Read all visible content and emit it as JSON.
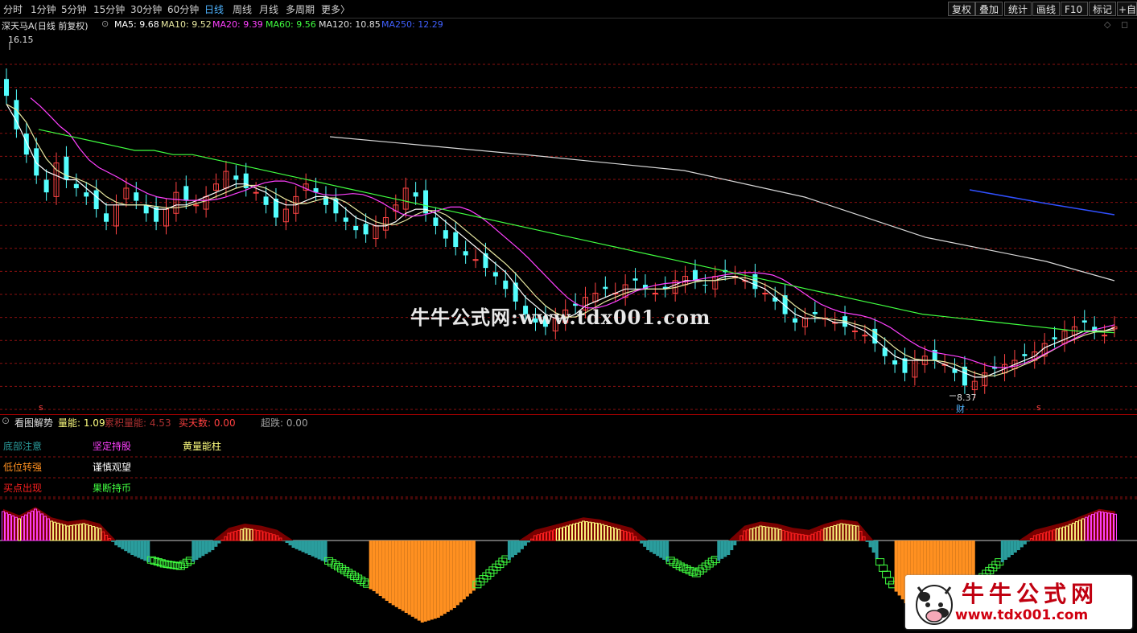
{
  "toolbar": {
    "periods": [
      "分时",
      "1分钟",
      "5分钟",
      "15分钟",
      "30分钟",
      "60分钟",
      "日线",
      "周线",
      "月线",
      "多周期",
      "更多〉"
    ],
    "active_period": "日线",
    "tools": [
      "复权",
      "叠加",
      "统计",
      "画线",
      "F10",
      "标记",
      "+自选"
    ]
  },
  "stock": {
    "name_label": "深天马A(日线 前复权)",
    "ma": [
      {
        "label": "MA5: 9.68",
        "color": "#ffffff"
      },
      {
        "label": "MA10: 9.52",
        "color": "#e8e8a0"
      },
      {
        "label": "MA20: 9.39",
        "color": "#ff40ff"
      },
      {
        "label": "MA60: 9.56",
        "color": "#40ff40"
      },
      {
        "label": "MA120: 10.85",
        "color": "#e0e0e0"
      },
      {
        "label": "MA250: 12.29",
        "color": "#4060ff"
      }
    ],
    "high_label": "16.15",
    "low_label": "8.37",
    "marker_cai": "财",
    "marker_s": "s"
  },
  "indicator": {
    "name": "看图解势",
    "values": [
      {
        "label": "量能: 1.09",
        "color": "#ffff80"
      },
      {
        "label": "累积量能: 4.53",
        "color": "#aa3030"
      },
      {
        "label": "买天数: 0.00",
        "color": "#ff4040"
      },
      {
        "label": "超跌: 0.00",
        "color": "#a0a0a0"
      }
    ],
    "legend": [
      {
        "text": "底部注意",
        "color": "#2a9d9d"
      },
      {
        "text": "坚定持股",
        "color": "#ff40ff"
      },
      {
        "text": "黄量能柱",
        "color": "#ffff80"
      },
      {
        "text": "低位转强",
        "color": "#ff9020"
      },
      {
        "text": "谨慎观望",
        "color": "#ffffff"
      },
      {
        "text": "买点出现",
        "color": "#ff2020"
      },
      {
        "text": "果断持币",
        "color": "#40ff40"
      }
    ]
  },
  "watermark": "牛牛公式网:www.tdx001.com",
  "logo": {
    "name": "牛牛公式网",
    "url": "www.tdx001.com"
  },
  "chart_data": [
    {
      "type": "candlestick",
      "title": "深天马A(日线 前复权)",
      "ylim": [
        8.0,
        16.6
      ],
      "grid": true,
      "annotated_high": 16.15,
      "annotated_low": 8.37,
      "series": [
        {
          "name": "close",
          "values": [
            15.2,
            14.4,
            13.8,
            13.3,
            12.9,
            13.6,
            13.2,
            13.0,
            12.8,
            12.5,
            12.2,
            12.6,
            13.0,
            12.7,
            12.4,
            12.2,
            12.5,
            12.9,
            12.7,
            12.6,
            12.8,
            13.1,
            13.4,
            13.2,
            13.0,
            12.9,
            12.6,
            12.3,
            12.5,
            12.8,
            13.1,
            12.9,
            12.6,
            12.4,
            12.2,
            12.0,
            11.9,
            12.1,
            12.3,
            12.6,
            13.0,
            12.8,
            12.4,
            12.1,
            11.8,
            11.6,
            11.4,
            11.3,
            11.1,
            10.9,
            10.6,
            10.3,
            10.0,
            9.8,
            9.7,
            9.9,
            10.1,
            10.2,
            10.4,
            10.5,
            10.6,
            10.5,
            10.7,
            10.8,
            10.6,
            10.5,
            10.6,
            10.8,
            10.9,
            10.8,
            10.7,
            10.9,
            11.0,
            10.9,
            10.8,
            10.6,
            10.5,
            10.3,
            10.0,
            9.8,
            9.9,
            10.0,
            9.9,
            9.8,
            9.7,
            9.6,
            9.5,
            9.3,
            9.0,
            8.8,
            8.6,
            8.9,
            9.0,
            8.9,
            8.8,
            8.6,
            8.3,
            8.4,
            8.6,
            8.7,
            8.8,
            8.9,
            9.0,
            9.1,
            9.3,
            9.4,
            9.6,
            9.7,
            9.8,
            9.6,
            9.5,
            9.7
          ]
        },
        {
          "name": "MA5",
          "values": [
            15.0,
            14.6,
            14.1,
            13.6,
            13.4,
            13.3,
            13.2,
            13.2,
            13.0,
            12.8,
            12.6,
            12.6,
            12.6,
            12.6,
            12.6,
            12.5,
            12.5,
            12.6,
            12.6,
            12.7,
            12.8,
            12.9,
            13.0,
            13.1,
            13.1,
            13.0,
            12.9,
            12.7,
            12.6,
            12.6,
            12.7,
            12.8,
            12.8,
            12.7,
            12.5,
            12.3,
            12.2,
            12.1,
            12.1,
            12.2,
            12.4,
            12.5,
            12.5,
            12.4,
            12.2,
            12.0,
            11.8,
            11.6,
            11.4,
            11.2,
            11.0,
            10.7,
            10.4,
            10.2,
            10.0,
            9.9,
            9.9,
            10.0,
            10.2,
            10.3,
            10.4,
            10.5,
            10.6,
            10.6,
            10.6,
            10.6,
            10.6,
            10.7,
            10.8,
            10.8,
            10.8,
            10.8,
            10.9,
            10.9,
            10.8,
            10.7,
            10.6,
            10.4,
            10.2,
            10.0,
            9.9,
            9.9,
            9.9,
            9.8,
            9.8,
            9.7,
            9.6,
            9.4,
            9.2,
            9.0,
            8.9,
            8.9,
            8.9,
            8.9,
            8.8,
            8.7,
            8.6,
            8.5,
            8.5,
            8.6,
            8.7,
            8.8,
            8.9,
            9.0,
            9.2,
            9.3,
            9.4,
            9.5,
            9.6,
            9.6,
            9.6,
            9.68
          ]
        },
        {
          "name": "MA60",
          "values": [
            14.4,
            14.3,
            14.2,
            14.1,
            14.0,
            13.9,
            13.9,
            13.8,
            13.8,
            13.7,
            13.6,
            13.5,
            13.4,
            13.3,
            13.2,
            13.1,
            13.0,
            12.9,
            12.8,
            12.7,
            12.6,
            12.5,
            12.4,
            12.3,
            12.2,
            12.1,
            12.0,
            11.9,
            11.8,
            11.7,
            11.6,
            11.5,
            11.4,
            11.3,
            11.2,
            11.1,
            11.0,
            10.9,
            10.8,
            10.7,
            10.6,
            10.5,
            10.4,
            10.3,
            10.2,
            10.1,
            10.0,
            9.95,
            9.9,
            9.85,
            9.8,
            9.75,
            9.7,
            9.65,
            9.6,
            9.58,
            9.56
          ]
        }
      ]
    },
    {
      "type": "bar",
      "title": "看图解势",
      "ylabel": "",
      "series": [
        {
          "name": "量能",
          "values": [
            1.2,
            0.9,
            1.3,
            0.8,
            0.6,
            0.7,
            0.5,
            -0.2,
            -0.6,
            -0.9,
            -1.1,
            -1.2,
            -0.8,
            -0.4,
            0.3,
            0.5,
            0.4,
            0.2,
            -0.3,
            -0.6,
            -0.9,
            -1.3,
            -1.7,
            -2.1,
            -2.6,
            -3.0,
            -3.4,
            -3.2,
            -2.8,
            -2.2,
            -1.6,
            -1.0,
            -0.5,
            0.2,
            0.4,
            0.6,
            0.8,
            0.7,
            0.5,
            0.3,
            -0.4,
            -0.8,
            -1.2,
            -1.5,
            -1.0,
            -0.6,
            0.4,
            0.6,
            0.5,
            0.3,
            0.2,
            0.5,
            0.7,
            0.6,
            -0.5,
            -1.8,
            -2.6,
            -3.2,
            -3.4,
            -2.8,
            -2.2,
            -1.5,
            -0.9,
            -0.4,
            0.2,
            0.4,
            0.6,
            0.9,
            1.2,
            1.09
          ]
        },
        {
          "name": "累积量能",
          "values": [
            4.53
          ]
        }
      ]
    }
  ]
}
